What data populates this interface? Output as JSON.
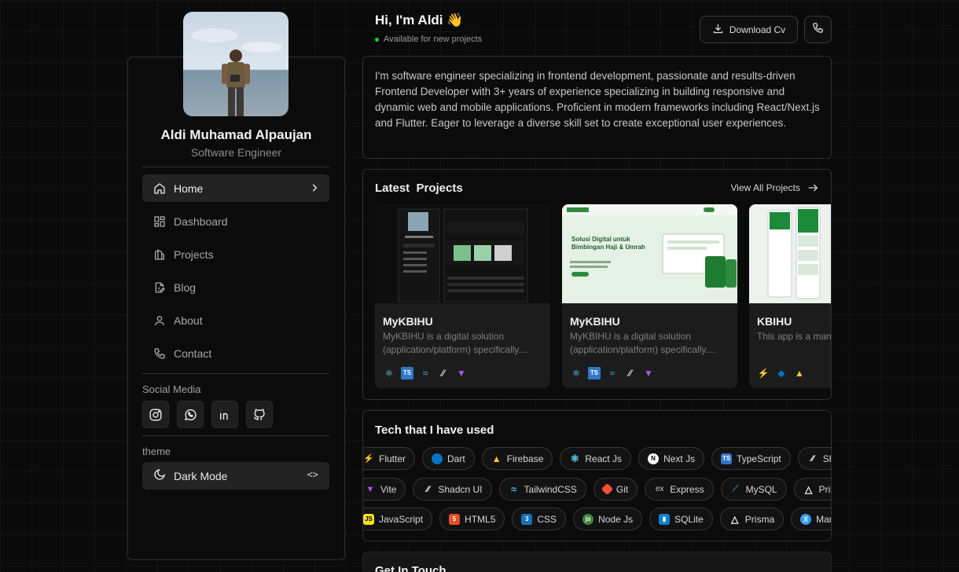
{
  "profile": {
    "name": "Aldi Muhamad Alpaujan",
    "role": "Software Engineer"
  },
  "nav": {
    "items": [
      {
        "label": "Home",
        "icon": "home-icon",
        "active": true
      },
      {
        "label": "Dashboard",
        "icon": "dashboard-icon"
      },
      {
        "label": "Projects",
        "icon": "projects-icon"
      },
      {
        "label": "Blog",
        "icon": "blog-icon"
      },
      {
        "label": "About",
        "icon": "user-icon"
      },
      {
        "label": "Contact",
        "icon": "phone-icon"
      }
    ]
  },
  "social": {
    "label": "Social Media",
    "items": [
      "instagram-icon",
      "whatsapp-icon",
      "linkedin-icon",
      "github-icon"
    ]
  },
  "theme": {
    "label": "theme",
    "value": "Dark Mode",
    "code": "<>"
  },
  "header": {
    "greeting": "Hi, I'm Aldi 👋",
    "status": "Available for new projects",
    "download_label": "Download Cv"
  },
  "about": {
    "text": "I'm software engineer specializing in frontend development, passionate and results-driven Frontend Developer with 3+ years of experience specializing in building responsive and dynamic web and mobile applications. Proficient in modern frameworks including React/Next.js and Flutter. Eager to leverage a diverse skill set to create exceptional user experiences."
  },
  "projects": {
    "title": "Latest  Projects",
    "view_all": "View All Projects",
    "items": [
      {
        "title": "MyKBIHU",
        "desc": "MyKBIHU is a digital solution (application/platform) specifically...."
      },
      {
        "title": "MyKBIHU",
        "desc": "MyKBIHU is a digital solution (application/platform) specifically....",
        "hero_title": "Solusi Digital untuk Bimbingan Haji & Umrah"
      },
      {
        "title": "KBIHU",
        "desc": "This app is a mana designed to let cu"
      }
    ]
  },
  "tech": {
    "title": "Tech that I have used",
    "row1": [
      "Flutter",
      "Dart",
      "Firebase",
      "React Js",
      "Next Js",
      "TypeScript",
      "Shadcn"
    ],
    "row2": [
      "Vite",
      "Shadcn UI",
      "TailwindCSS",
      "Git",
      "Express",
      "MySQL",
      "Prisma"
    ],
    "row3": [
      "JavaScript",
      "HTML5",
      "CSS",
      "Node Js",
      "SQLite",
      "Prisma",
      "Mantine"
    ]
  },
  "contact": {
    "title": "Get In Touch"
  },
  "colors": {
    "accent_green": "#22c55e",
    "background": "#0a0a0a"
  }
}
